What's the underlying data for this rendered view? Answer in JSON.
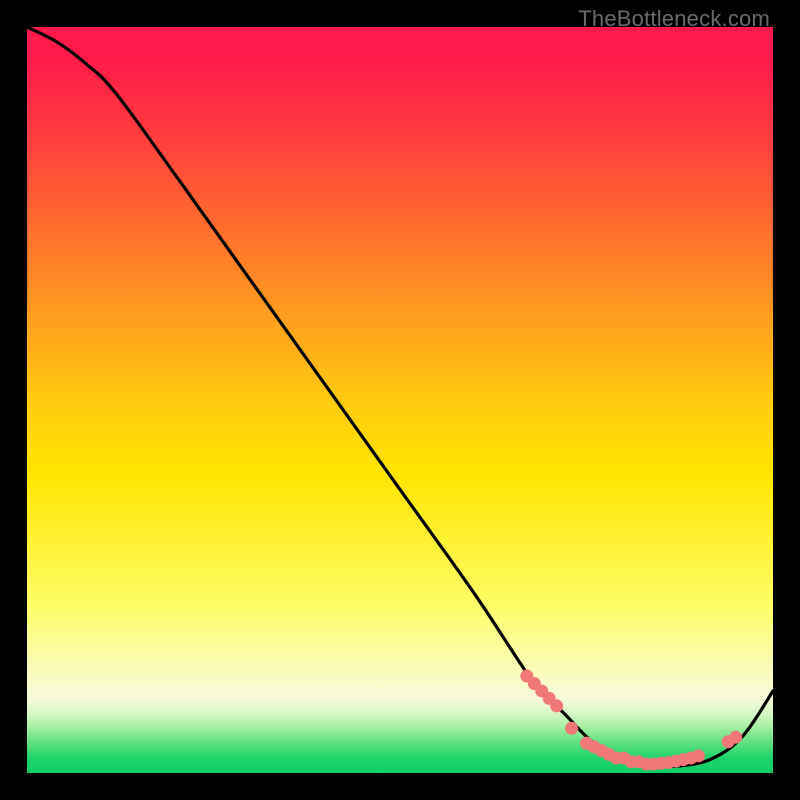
{
  "watermark": "TheBottleneck.com",
  "chart_data": {
    "type": "line",
    "title": "",
    "xlabel": "",
    "ylabel": "",
    "xlim": [
      0,
      100
    ],
    "ylim": [
      0,
      100
    ],
    "series": [
      {
        "name": "curve",
        "x": [
          0,
          4,
          8,
          12,
          20,
          30,
          40,
          50,
          60,
          68,
          72,
          76,
          80,
          84,
          88,
          92,
          96,
          100
        ],
        "values": [
          100,
          98,
          95,
          91,
          80,
          66,
          52,
          38,
          24,
          12,
          8,
          4,
          2,
          1,
          1,
          2,
          5,
          11
        ]
      }
    ],
    "highlight_points": {
      "comment": "salmon dot clusters along the valley",
      "x": [
        67,
        68,
        69,
        70,
        71,
        73,
        75,
        76,
        77,
        78,
        79,
        80,
        81,
        82,
        83,
        84,
        85,
        86,
        87,
        88,
        89,
        90,
        94,
        95
      ],
      "values": [
        13,
        12,
        11,
        10,
        9,
        6,
        4,
        3.5,
        3,
        2.5,
        2,
        2,
        1.5,
        1.5,
        1.2,
        1.2,
        1.3,
        1.4,
        1.6,
        1.8,
        2.0,
        2.3,
        4.2,
        4.8
      ]
    },
    "colors": {
      "curve": "#000000",
      "points": "#f07878"
    }
  }
}
